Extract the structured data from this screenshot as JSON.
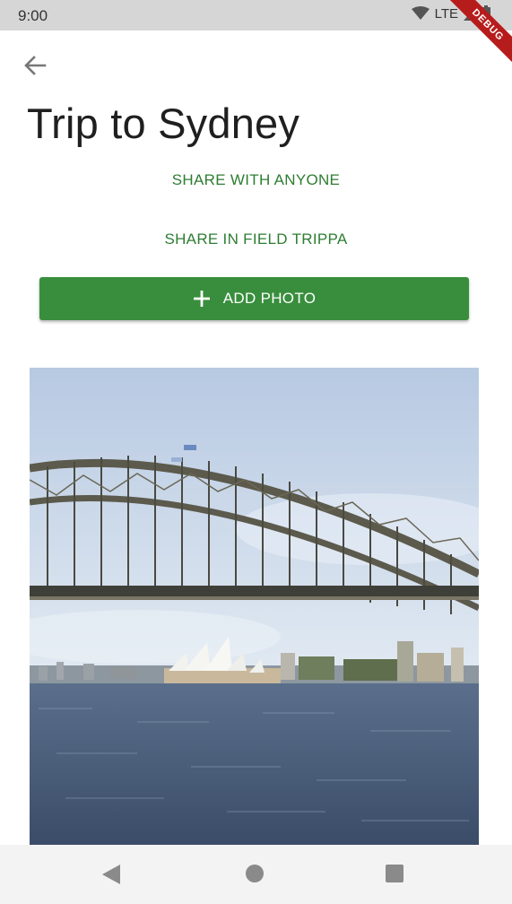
{
  "status_bar": {
    "time": "9:00",
    "network": "LTE",
    "icons": [
      "wifi-icon",
      "signal-icon",
      "battery-icon"
    ]
  },
  "debug_banner": "DEBUG",
  "app_bar": {
    "back_icon": "arrow-back-icon"
  },
  "title": "Trip to Sydney",
  "actions": {
    "share_anyone": "SHARE WITH ANYONE",
    "share_field": "SHARE IN FIELD TRIPPA",
    "add_photo": "ADD PHOTO",
    "add_photo_icon": "plus-icon"
  },
  "photo": {
    "subject": "sydney-harbour-bridge-photo"
  },
  "nav_bar": {
    "icons": [
      "back-triangle-icon",
      "home-circle-icon",
      "recents-square-icon"
    ]
  },
  "colors": {
    "accent": "#2e7d32",
    "button": "#388e3c",
    "status_bar": "#d6d6d6",
    "debug": "#b71c1c"
  }
}
